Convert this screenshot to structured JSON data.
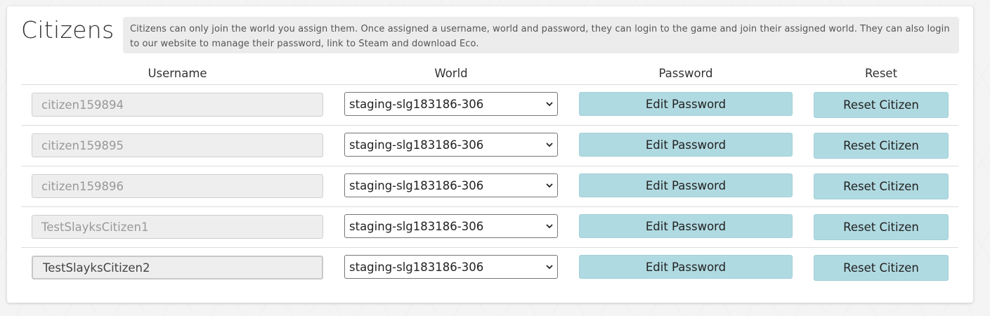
{
  "section": {
    "title": "Citizens",
    "info": "Citizens can only join the world you assign them. Once assigned a username, world and password, they can login to the game and join their assigned world. They can also login to our website to manage their password, link to Steam and download Eco."
  },
  "table": {
    "headers": {
      "username": "Username",
      "world": "World",
      "password": "Password",
      "reset": "Reset"
    },
    "rows": [
      {
        "username": "citizen159894",
        "world": "staging-slg183186-306",
        "password_button": "Edit Password",
        "reset_button": "Reset Citizen"
      },
      {
        "username": "citizen159895",
        "world": "staging-slg183186-306",
        "password_button": "Edit Password",
        "reset_button": "Reset Citizen"
      },
      {
        "username": "citizen159896",
        "world": "staging-slg183186-306",
        "password_button": "Edit Password",
        "reset_button": "Reset Citizen"
      },
      {
        "username": "TestSlayksCitizen1",
        "world": "staging-slg183186-306",
        "password_button": "Edit Password",
        "reset_button": "Reset Citizen"
      },
      {
        "username": "TestSlayksCitizen2",
        "world": "staging-slg183186-306",
        "password_button": "Edit Password",
        "reset_button": "Reset Citizen"
      }
    ]
  },
  "icons": {
    "select_arrow": "chevron-down-icon"
  },
  "colors": {
    "button_bg": "#b0dae1",
    "info_bg": "#ececec",
    "input_bg": "#eeeeee"
  }
}
